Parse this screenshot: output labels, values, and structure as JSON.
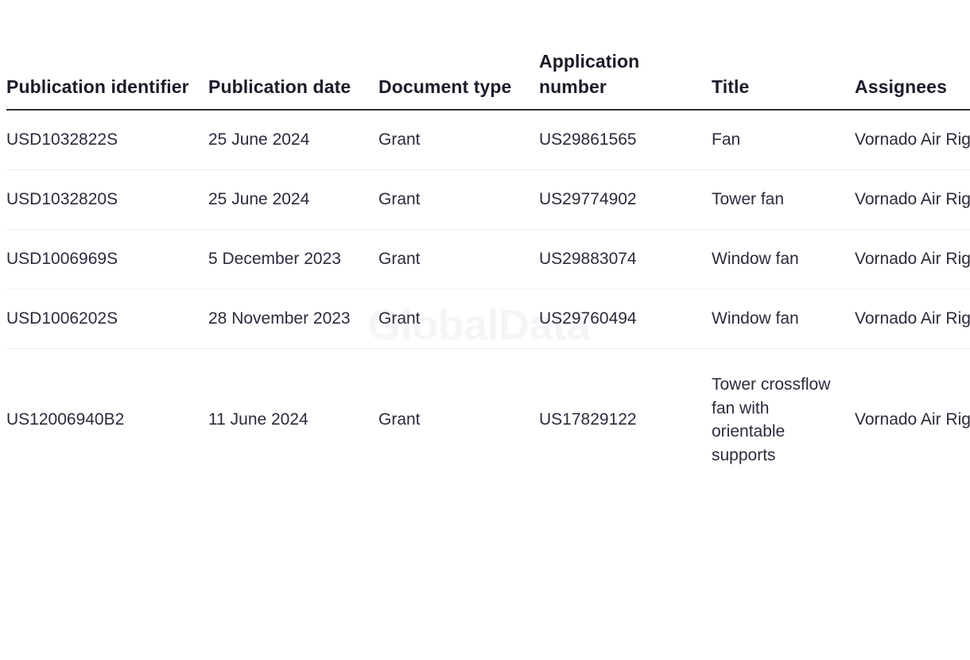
{
  "watermark": {
    "text": "GlobalData"
  },
  "table": {
    "columns": [
      {
        "key": "publication_identifier",
        "label": "Publication identifier"
      },
      {
        "key": "publication_date",
        "label": "Publication date"
      },
      {
        "key": "document_type",
        "label": "Document type"
      },
      {
        "key": "application_number",
        "label": "Application number"
      },
      {
        "key": "title",
        "label": "Title"
      },
      {
        "key": "assignees",
        "label": "Assignees"
      }
    ],
    "rows": [
      {
        "publication_identifier": "USD1032822S",
        "publication_date": "25 June 2024",
        "document_type": "Grant",
        "application_number": "US29861565",
        "title": "Fan",
        "assignees": "Vornado Air Rights LLC"
      },
      {
        "publication_identifier": "USD1032820S",
        "publication_date": "25 June 2024",
        "document_type": "Grant",
        "application_number": "US29774902",
        "title": "Tower fan",
        "assignees": "Vornado Air Rights LLC"
      },
      {
        "publication_identifier": "USD1006969S",
        "publication_date": "5 December 2023",
        "document_type": "Grant",
        "application_number": "US29883074",
        "title": "Window fan",
        "assignees": "Vornado Air Rights LLC"
      },
      {
        "publication_identifier": "USD1006202S",
        "publication_date": "28 November 2023",
        "document_type": "Grant",
        "application_number": "US29760494",
        "title": "Window fan",
        "assignees": "Vornado Air Rights LLC"
      },
      {
        "publication_identifier": "US12006940B2",
        "publication_date": "11 June 2024",
        "document_type": "Grant",
        "application_number": "US17829122",
        "title": "Tower crossflow fan with orientable supports",
        "assignees": "Vornado Air Rights LLC"
      }
    ]
  },
  "colors": {
    "header_text": "#1b1b2a",
    "body_text": "#2b2b3d",
    "header_rule": "#2f2f33",
    "row_divider": "#eceef0",
    "watermark": "#f4f5f7",
    "background": "#ffffff"
  }
}
